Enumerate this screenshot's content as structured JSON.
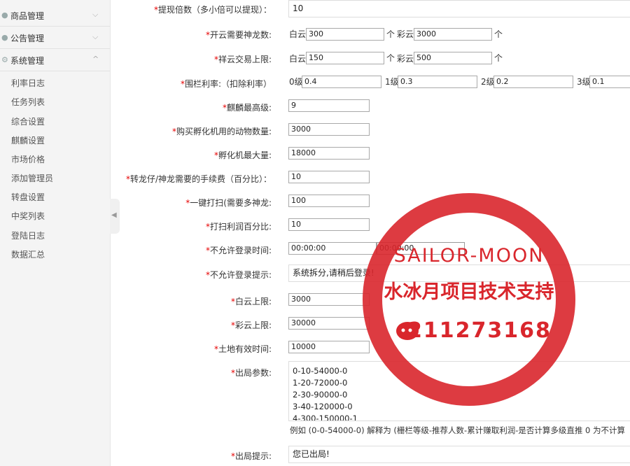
{
  "sidebar": {
    "groups": [
      {
        "label": "商品管理",
        "icon": "chat-icon",
        "chevron": "⌵"
      },
      {
        "label": "公告管理",
        "icon": "chat-icon",
        "chevron": "⌵"
      },
      {
        "label": "系统管理",
        "icon": "gear-icon",
        "chevron": "^"
      }
    ],
    "items": [
      "利率日志",
      "任务列表",
      "综合设置",
      "麒麟设置",
      "市场价格",
      "添加管理员",
      "转盘设置",
      "中奖列表",
      "登陆日志",
      "数据汇总"
    ]
  },
  "form": {
    "withdraw_multiple": {
      "label": "提现倍数（多小倍可以提现）：",
      "value": "10"
    },
    "open_cloud": {
      "label": "开云需要神龙数:",
      "white_label": "白云",
      "white_value": "300",
      "unit": "个",
      "color_label": "彩云",
      "color_value": "3000"
    },
    "xiangyun_limit": {
      "label": "祥云交易上限:",
      "white_label": "白云",
      "white_value": "150",
      "unit": "个",
      "color_label": "彩云",
      "color_value": "500"
    },
    "fence_rate": {
      "label": "围栏利率:（扣除利率）",
      "levels": [
        {
          "label": "0级",
          "value": "0.4"
        },
        {
          "label": "1级",
          "value": "0.3"
        },
        {
          "label": "2级",
          "value": "0.2"
        },
        {
          "label": "3级",
          "value": "0.1"
        }
      ]
    },
    "qilin_max_level": {
      "label": "麒麟最高级:",
      "value": "9"
    },
    "incubator_animals": {
      "label": "购买孵化机用的动物数量:",
      "value": "3000"
    },
    "incubator_max": {
      "label": "孵化机最大量:",
      "value": "18000"
    },
    "convert_fee": {
      "label": "转龙仔/神龙需要的手续费（百分比）：",
      "value": "10"
    },
    "one_key_sweep": {
      "label": "一键打扫(需要多神龙:",
      "value": "100"
    },
    "sweep_profit": {
      "label": "打扫利润百分比:",
      "value": "10"
    },
    "no_login_time": {
      "label": "不允许登录时间:",
      "start": "00:00:00",
      "end": "00:00:00"
    },
    "no_login_tip": {
      "label": "不允许登录提示:",
      "value": "系统拆分,请稍后登录!"
    },
    "white_cloud_limit": {
      "label": "白云上限:",
      "value": "3000"
    },
    "color_cloud_limit": {
      "label": "彩云上限:",
      "value": "30000"
    },
    "land_valid_time": {
      "label": "土地有效时间:",
      "value": "10000"
    },
    "exit_params": {
      "label": "出局参数:",
      "lines": [
        "0-10-54000-0",
        "1-20-72000-0",
        "2-30-90000-0",
        "3-40-120000-0",
        "4-300-150000-1"
      ],
      "hint": "例如 (0-0-54000-0) 解释为 (栅栏等级-推荐人数-累计赚取利润-是否计算多级直推 0 为不计算"
    },
    "exit_tip": {
      "label": "出局提示:",
      "value": "您已出局!"
    }
  },
  "stamp": {
    "line1": "SAILOR-MOON",
    "line2": "水冰月项目技术支持",
    "line3": "211273168",
    "color": "#d9262c"
  },
  "colors": {
    "required_star": "#e60000",
    "sidebar_bg": "#f4f4f4"
  }
}
